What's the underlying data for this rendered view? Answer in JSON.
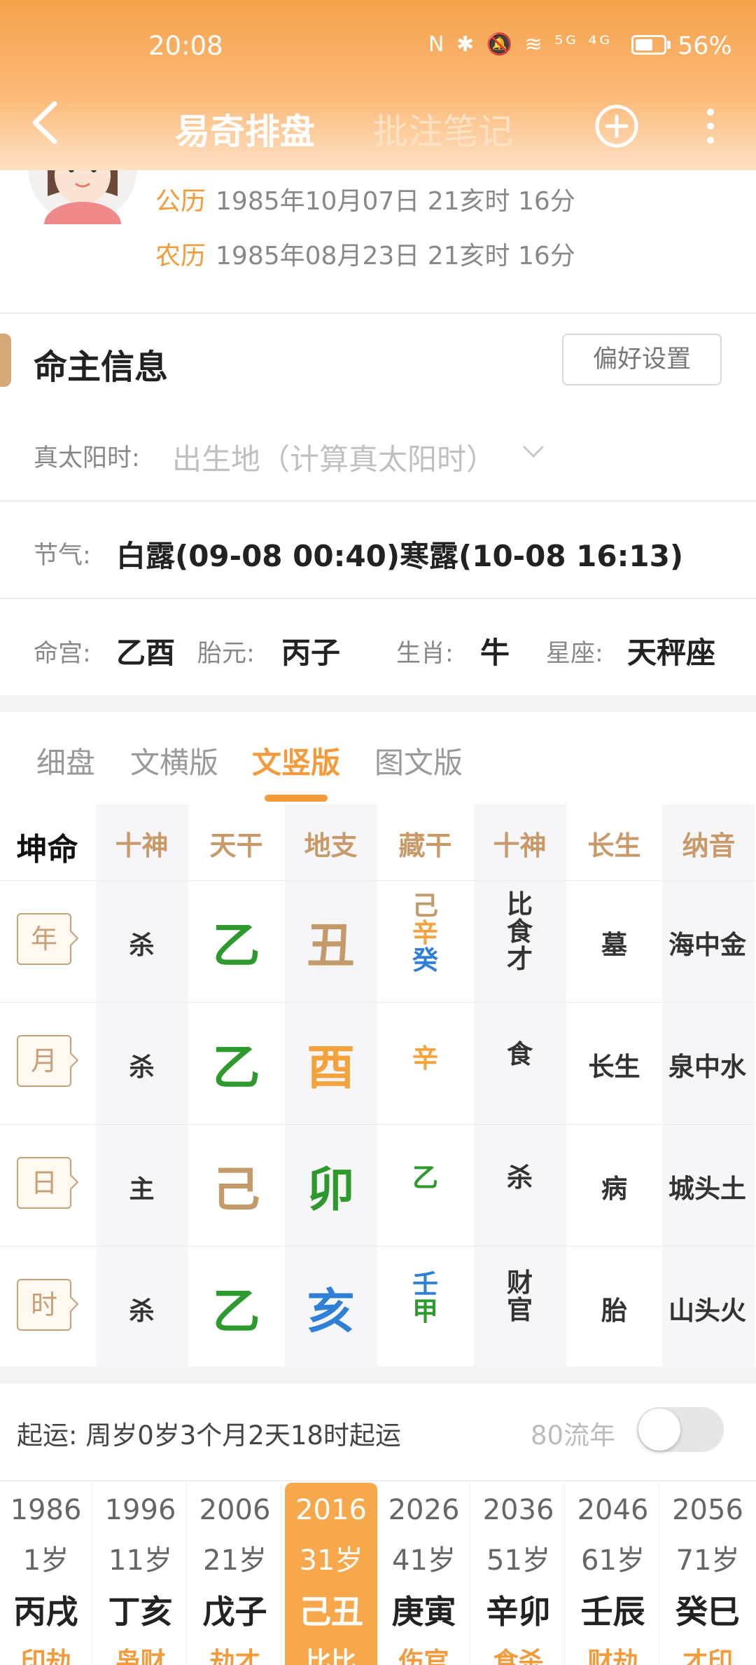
{
  "status_bar": {
    "time": "20:08",
    "icons": "N ✱ 🔕 ≋ ⁵ᴳ ⁴ᴳ",
    "battery": "56%"
  },
  "nav": {
    "tab_active": "易奇排盘",
    "tab_inactive": "批注笔记"
  },
  "profile": {
    "solar_label": "公历",
    "solar_value": "1985年10月07日 21亥时 16分",
    "lunar_label": "农历",
    "lunar_value": "1985年08月23日 21亥时 16分"
  },
  "owner": {
    "section_title": "命主信息",
    "pref_button": "偏好设置",
    "solar_time_label": "真太阳时:",
    "solar_time_placeholder": "出生地（计算真太阳时）",
    "jieqi_label": "节气:",
    "jieqi_value": "白露(09-08 00:40)寒露(10-08 16:13)",
    "minggong_label": "命宫:",
    "minggong_value": "乙酉",
    "taiyuan_label": "胎元:",
    "taiyuan_value": "丙子",
    "shengxiao_label": "生肖:",
    "shengxiao_value": "牛",
    "xingzuo_label": "星座:",
    "xingzuo_value": "天秤座"
  },
  "view_tabs": [
    "细盘",
    "文横版",
    "文竖版",
    "图文版"
  ],
  "chart": {
    "corner": "坤命",
    "headers": [
      "十神",
      "天干",
      "地支",
      "藏干",
      "十神",
      "长生",
      "纳音"
    ],
    "rows": [
      {
        "pillar": "年",
        "god": "杀",
        "stem": "乙",
        "branch": "丑",
        "hidden": [
          "己",
          "辛",
          "癸"
        ],
        "hidden_gods": [
          "比",
          "食",
          "才"
        ],
        "stage": "墓",
        "nayin": "海中金"
      },
      {
        "pillar": "月",
        "god": "杀",
        "stem": "乙",
        "branch": "酉",
        "hidden": [
          "辛"
        ],
        "hidden_gods": [
          "食"
        ],
        "stage": "长生",
        "nayin": "泉中水"
      },
      {
        "pillar": "日",
        "god": "主",
        "stem": "己",
        "branch": "卯",
        "hidden": [
          "乙"
        ],
        "hidden_gods": [
          "杀"
        ],
        "stage": "病",
        "nayin": "城头土"
      },
      {
        "pillar": "时",
        "god": "杀",
        "stem": "乙",
        "branch": "亥",
        "hidden": [
          "壬",
          "甲"
        ],
        "hidden_gods": [
          "财",
          "官"
        ],
        "stage": "胎",
        "nayin": "山头火"
      }
    ]
  },
  "qiyun": {
    "text": "起运:  周岁0岁3个月2天18时起运",
    "liunian_label": "80流年"
  },
  "dayun": [
    {
      "year": "1986",
      "age": "1岁",
      "ganzhi": "丙戌",
      "gods": "印劫"
    },
    {
      "year": "1996",
      "age": "11岁",
      "ganzhi": "丁亥",
      "gods": "枭财"
    },
    {
      "year": "2006",
      "age": "21岁",
      "ganzhi": "戊子",
      "gods": "劫才"
    },
    {
      "year": "2016",
      "age": "31岁",
      "ganzhi": "己丑",
      "gods": "比比"
    },
    {
      "year": "2026",
      "age": "41岁",
      "ganzhi": "庚寅",
      "gods": "伤官"
    },
    {
      "year": "2036",
      "age": "51岁",
      "ganzhi": "辛卯",
      "gods": "食杀"
    },
    {
      "year": "2046",
      "age": "61岁",
      "ganzhi": "壬辰",
      "gods": "财劫"
    },
    {
      "year": "2056",
      "age": "71岁",
      "ganzhi": "癸巳",
      "gods": "才印"
    }
  ],
  "colors": {
    "accent": "#f39b3a",
    "wood": "#2e9a2e",
    "earth": "#c39b6a",
    "metal": "#f5a23c",
    "water": "#2f7fd6"
  }
}
